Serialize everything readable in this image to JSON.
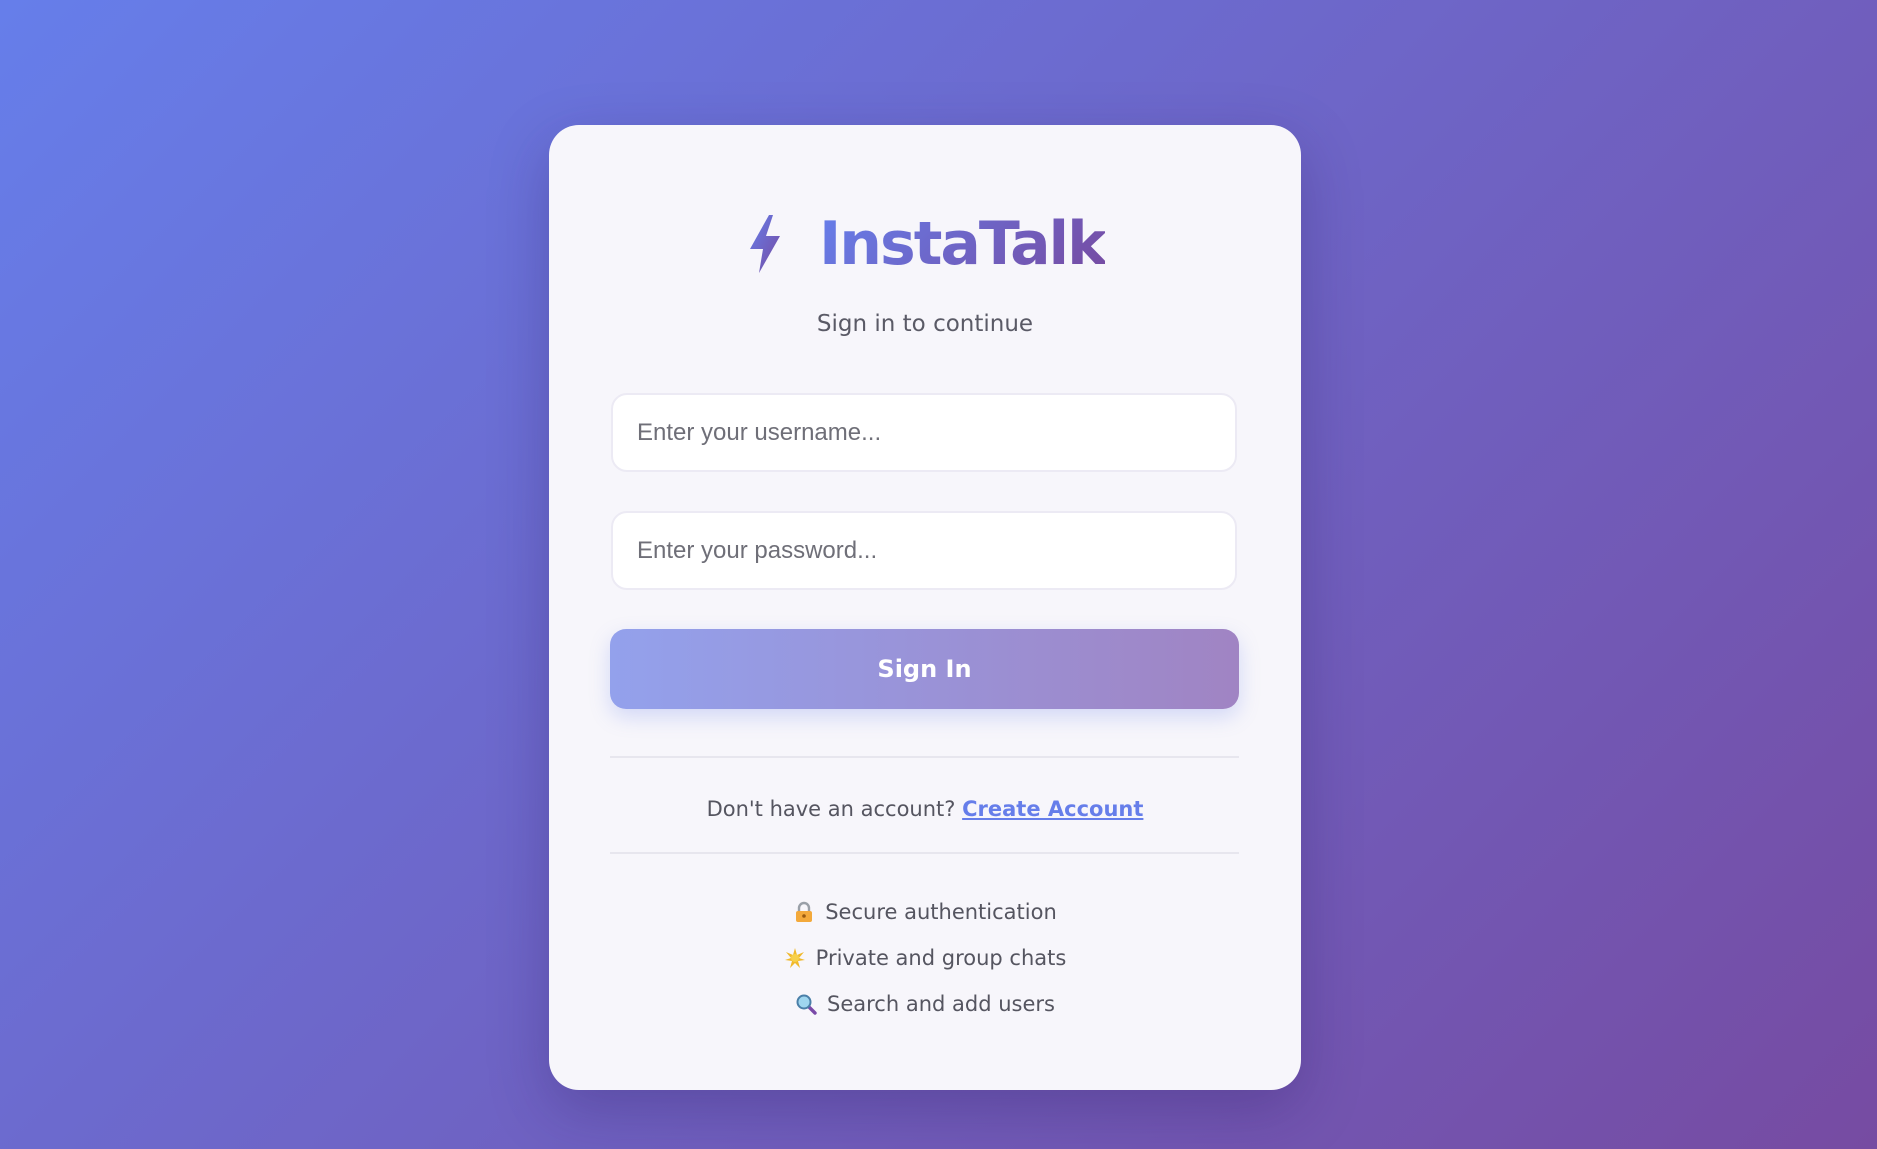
{
  "app": {
    "name": "InstaTalk",
    "subtitle": "Sign in to continue",
    "accent_start": "#667eea",
    "accent_end": "#764ba2",
    "logo_icon": "lightning-bolt-icon"
  },
  "form": {
    "username_placeholder": "Enter your username...",
    "password_placeholder": "Enter your password...",
    "submit_label": "Sign In"
  },
  "signup": {
    "prompt": "Don't have an account?",
    "link_label": "Create Account"
  },
  "features": [
    {
      "icon": "lock-icon",
      "label": "Secure authentication"
    },
    {
      "icon": "sparkle-icon",
      "label": "Private and group chats"
    },
    {
      "icon": "magnifier-icon",
      "label": "Search and add users"
    }
  ]
}
